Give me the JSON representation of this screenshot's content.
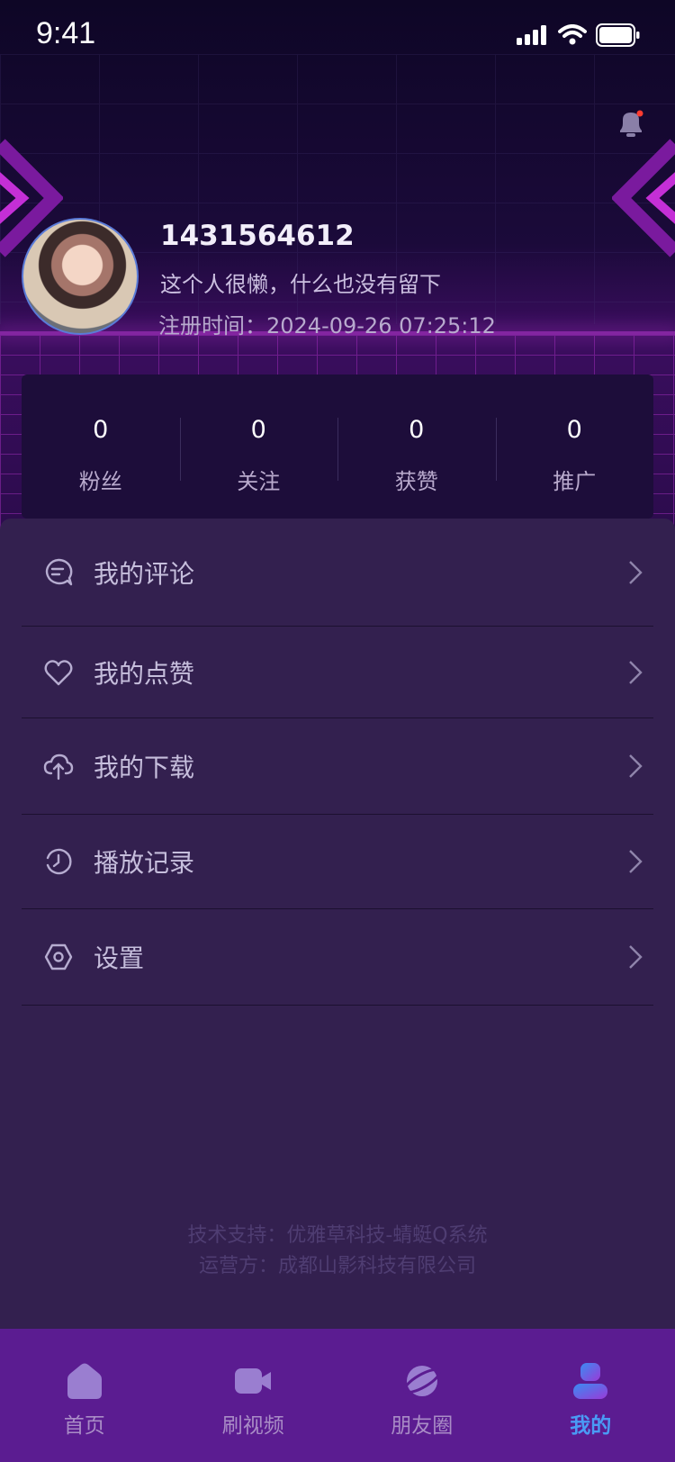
{
  "status_bar": {
    "time": "9:41"
  },
  "profile": {
    "user_id": "1431564612",
    "bio": "这个人很懒，什么也没有留下",
    "register_time": "注册时间：2024-09-26 07:25:12"
  },
  "stats": [
    {
      "value": "0",
      "label": "粉丝"
    },
    {
      "value": "0",
      "label": "关注"
    },
    {
      "value": "0",
      "label": "获赞"
    },
    {
      "value": "0",
      "label": "推广"
    }
  ],
  "menu": [
    {
      "label": "我的评论",
      "icon": "comment-icon"
    },
    {
      "label": "我的点赞",
      "icon": "heart-icon"
    },
    {
      "label": "我的下载",
      "icon": "cloud-upload-icon"
    },
    {
      "label": "播放记录",
      "icon": "history-clock-icon"
    },
    {
      "label": "设置",
      "icon": "settings-hexagon-icon"
    }
  ],
  "footer": {
    "tech_support": "技术支持：优雅草科技-蜻蜓Q系统",
    "operator": "运营方：成都山影科技有限公司"
  },
  "tabbar": [
    {
      "label": "首页",
      "icon": "home-icon",
      "active": false
    },
    {
      "label": "刷视频",
      "icon": "video-camera-icon",
      "active": false
    },
    {
      "label": "朋友圈",
      "icon": "planet-icon",
      "active": false
    },
    {
      "label": "我的",
      "icon": "user-icon",
      "active": true
    }
  ],
  "colors": {
    "accent_active": "#4a9bf5",
    "tabbar_bg": "#5b1c91",
    "menu_bg": "#33204f",
    "notification_dot": "#ff3b30"
  }
}
